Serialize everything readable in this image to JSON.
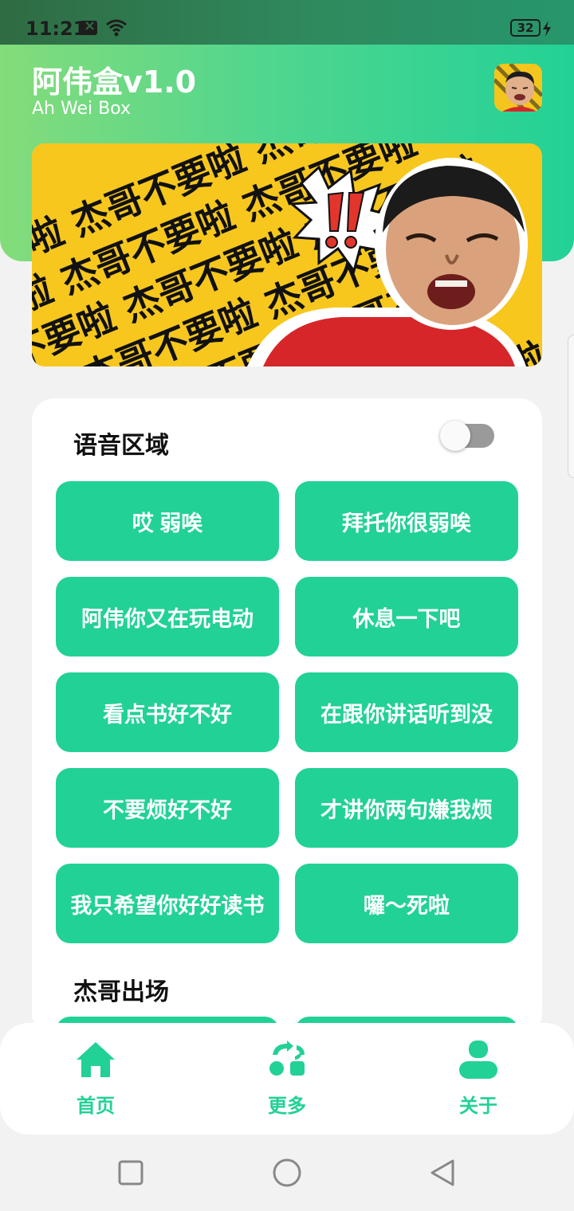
{
  "status_bar": {
    "time": "11:21",
    "battery": "32"
  },
  "header": {
    "title": "阿伟盒v1.0",
    "subtitle": "Ah Wei Box"
  },
  "banner": {
    "pattern_text": "杰哥不要啦",
    "sticker_text": "!!"
  },
  "voice_section": {
    "title": "语音区域",
    "toggle_on": false,
    "buttons": [
      "哎 弱唉",
      "拜托你很弱唉",
      "阿伟你又在玩电动",
      "休息一下吧",
      "看点书好不好",
      "在跟你讲话听到没",
      "不要烦好不好",
      "才讲你两句嫌我烦",
      "我只希望你好好读书",
      "囉～死啦"
    ]
  },
  "jie_section": {
    "title": "杰哥出场"
  },
  "bottom_nav": {
    "items": [
      {
        "label": "首页",
        "icon": "home-icon"
      },
      {
        "label": "更多",
        "icon": "more-icon"
      },
      {
        "label": "关于",
        "icon": "about-icon"
      }
    ]
  },
  "colors": {
    "accent": "#22d195",
    "header_start": "#84dc7a",
    "header_end": "#22d196",
    "banner_yellow": "#f7c71e"
  }
}
